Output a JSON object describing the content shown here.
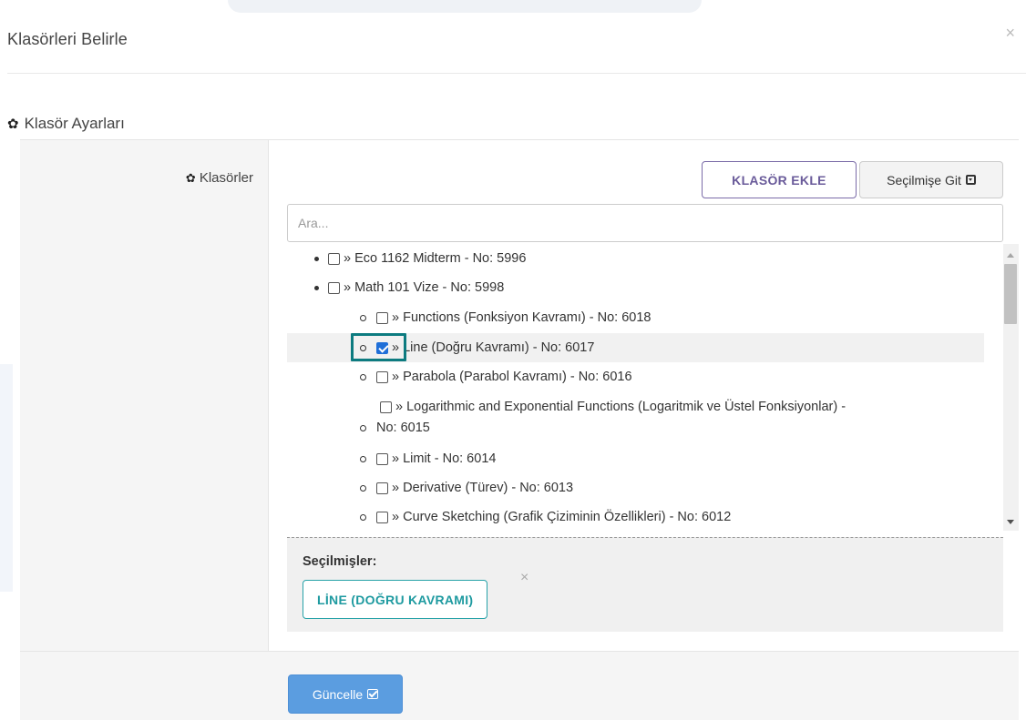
{
  "modal": {
    "title": "Klasörleri Belirle",
    "close_symbol": "×"
  },
  "section": {
    "title": "Klasör Ayarları",
    "icon": "gear-icon"
  },
  "form": {
    "folders_label": "Klasörler",
    "add_folder_button": "KLASÖR EKLE",
    "goto_selected_button": "Seçilmişe Git",
    "search_placeholder": "Ara..."
  },
  "tree": {
    "items": [
      {
        "level": 1,
        "text": "» Eco 1162 Midterm - No: 5996",
        "checked": false
      },
      {
        "level": 1,
        "text": "» Math 101 Vize - No: 5998",
        "checked": false
      },
      {
        "level": 2,
        "text": "» Functions (Fonksiyon Kavramı) - No: 6018",
        "checked": false
      },
      {
        "level": 2,
        "text": "» Line (Doğru Kavramı) - No: 6017",
        "checked": true
      },
      {
        "level": 2,
        "text": "» Parabola (Parabol Kavramı) - No: 6016",
        "checked": false
      },
      {
        "level": 2,
        "text": "» Logarithmic and Exponential Functions (Logaritmik ve Üstel Fonksiyonlar) -",
        "text_cont": "No: 6015",
        "checked": false
      },
      {
        "level": 2,
        "text": "» Limit - No: 6014",
        "checked": false
      },
      {
        "level": 2,
        "text": "» Derivative (Türev) - No: 6013",
        "checked": false
      },
      {
        "level": 2,
        "text": "» Curve Sketching (Grafik Çiziminin Özellikleri) - No: 6012",
        "checked": false
      }
    ]
  },
  "selected": {
    "title": "Seçilmişler:",
    "chips": [
      {
        "label": "LİNE (DOĞRU KAVRAMI)"
      }
    ],
    "remove_symbol": "×"
  },
  "footer": {
    "update_button": "Güncelle"
  },
  "colors": {
    "accent_purple": "#6a5b9a",
    "teal": "#1e9aa0",
    "primary_blue": "#5b9de0",
    "checkbox_blue": "#1f6fd8"
  }
}
